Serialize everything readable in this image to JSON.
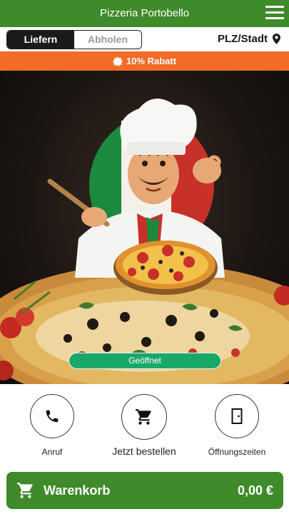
{
  "header": {
    "title": "Pizzeria Portobello"
  },
  "mode": {
    "delivery": "Liefern",
    "pickup": "Abholen",
    "location": "PLZ/Stadt"
  },
  "promo": {
    "text": "10% Rabatt"
  },
  "hero": {
    "status": "Geöffnet"
  },
  "actions": {
    "call": "Anruf",
    "order": "Jetzt bestellen",
    "hours": "Öffnungszeiten"
  },
  "cart": {
    "label": "Warenkorb",
    "total": "0,00 €"
  },
  "colors": {
    "brand_green": "#3f8a2a",
    "promo_orange": "#f26b27",
    "open_green": "#1aa86a"
  },
  "icons": {
    "menu": "hamburger-icon",
    "location": "map-pin-icon",
    "promo": "badge-icon",
    "call": "phone-icon",
    "order": "cart-icon",
    "hours": "door-icon",
    "cart": "cart-icon"
  }
}
